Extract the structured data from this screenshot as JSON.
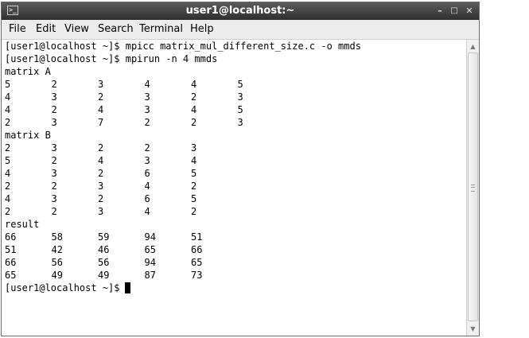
{
  "window": {
    "title": "user1@localhost:~"
  },
  "icons": {
    "terminal": "terminal-icon",
    "minimize": "minimize-icon",
    "maximize": "maximize-icon",
    "close": "close-icon"
  },
  "menu": [
    "File",
    "Edit",
    "View",
    "Search",
    "Terminal",
    "Help"
  ],
  "terminal": {
    "prompt": "[user1@localhost ~]$",
    "commands": [
      "mpicc matrix_mul_different_size.c -o mmds",
      "mpirun -n 4 mmds"
    ],
    "matrix_a_label": "matrix A",
    "matrix_a": [
      [
        "5",
        "2",
        "3",
        "4",
        "4",
        "5"
      ],
      [
        "4",
        "3",
        "2",
        "3",
        "2",
        "3"
      ],
      [
        "4",
        "2",
        "4",
        "3",
        "4",
        "5"
      ],
      [
        "2",
        "3",
        "7",
        "2",
        "2",
        "3"
      ]
    ],
    "matrix_b_label": "matrix B",
    "matrix_b": [
      [
        "2",
        "3",
        "2",
        "2",
        "3"
      ],
      [
        "5",
        "2",
        "4",
        "3",
        "4"
      ],
      [
        "4",
        "3",
        "2",
        "6",
        "5"
      ],
      [
        "2",
        "2",
        "3",
        "4",
        "2"
      ],
      [
        "4",
        "3",
        "2",
        "6",
        "5"
      ],
      [
        "2",
        "2",
        "3",
        "4",
        "2"
      ]
    ],
    "result_label": "result",
    "result": [
      [
        "66",
        "58",
        "59",
        "94",
        "51"
      ],
      [
        "51",
        "42",
        "46",
        "65",
        "66"
      ],
      [
        "66",
        "56",
        "56",
        "94",
        "65"
      ],
      [
        "65",
        "49",
        "49",
        "87",
        "73"
      ]
    ]
  }
}
